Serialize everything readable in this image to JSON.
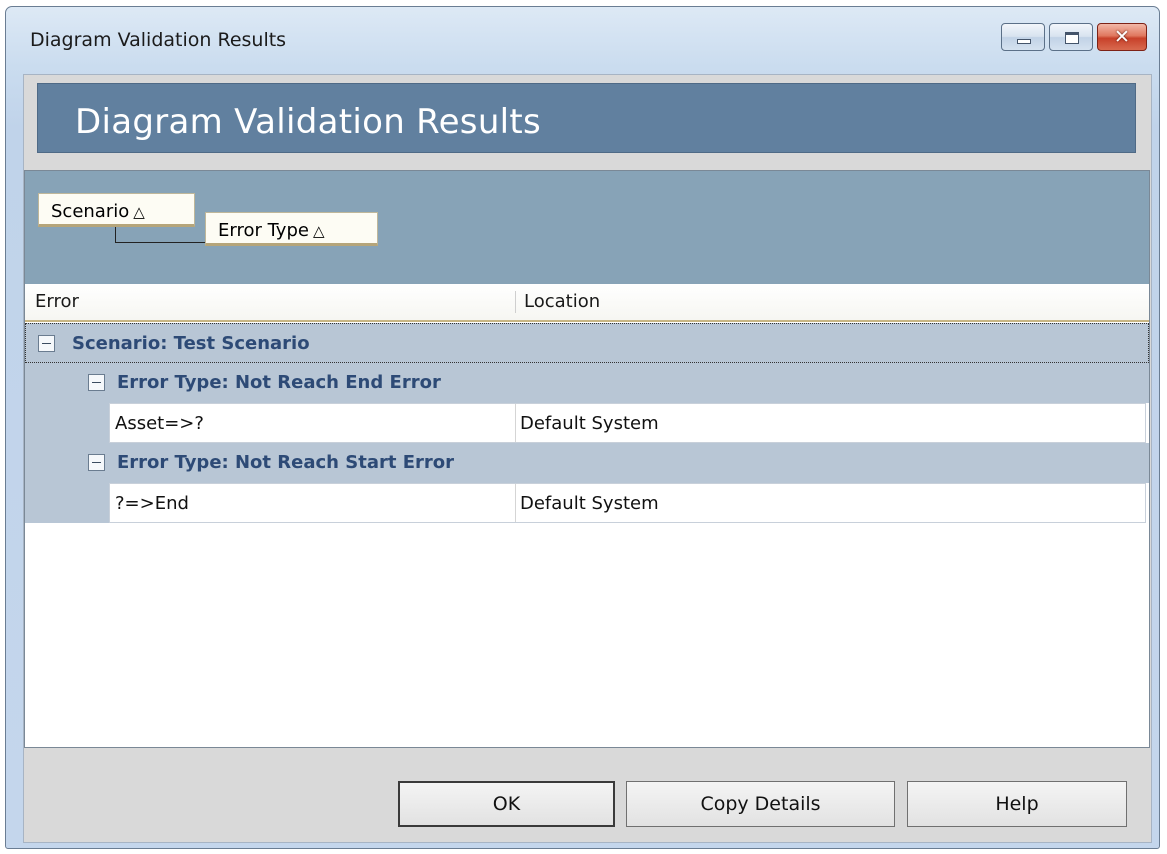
{
  "window": {
    "title": "Diagram Validation Results",
    "caption_buttons": [
      "minimize-icon",
      "maximize-icon",
      "close-icon"
    ],
    "close_glyph": "✕"
  },
  "banner": {
    "title": "Diagram Validation Results",
    "color": "#61809f"
  },
  "group_by": {
    "items": [
      {
        "label": "Scenario",
        "sort": "△"
      },
      {
        "label": "Error Type",
        "sort": "△"
      }
    ]
  },
  "grid": {
    "columns": [
      "Error",
      "Location"
    ],
    "groups": [
      {
        "label": "Scenario: Test Scenario",
        "subgroups": [
          {
            "label": "Error Type: Not Reach End Error",
            "rows": [
              {
                "error": "Asset=>?",
                "location": "Default System"
              }
            ]
          },
          {
            "label": "Error Type: Not Reach Start Error",
            "rows": [
              {
                "error": "?=>End",
                "location": "Default System"
              }
            ]
          }
        ]
      }
    ]
  },
  "buttons": {
    "ok": "OK",
    "copy": "Copy Details",
    "help": "Help"
  }
}
